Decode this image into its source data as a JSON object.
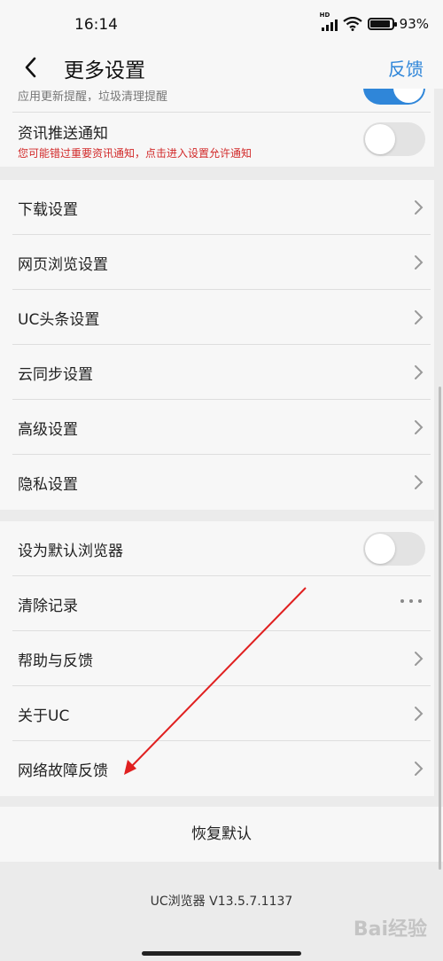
{
  "status_bar": {
    "time": "16:14",
    "network_badge": "HD",
    "battery": "93%"
  },
  "header": {
    "title": "更多设置",
    "feedback_label": "反馈"
  },
  "top_section": {
    "partial_sub_text": "应用更新提醒，垃圾清理提醒",
    "news_push": {
      "label": "资讯推送通知",
      "warning": "您可能错过重要资讯通知，点击进入设置允许通知",
      "enabled": false
    }
  },
  "settings_group": [
    {
      "label": "下载设置"
    },
    {
      "label": "网页浏览设置"
    },
    {
      "label": "UC头条设置"
    },
    {
      "label": "云同步设置"
    },
    {
      "label": "高级设置"
    },
    {
      "label": "隐私设置"
    }
  ],
  "misc_group": {
    "default_browser": {
      "label": "设为默认浏览器",
      "enabled": false
    },
    "clear_history": {
      "label": "清除记录"
    },
    "help_feedback": {
      "label": "帮助与反馈"
    },
    "about": {
      "label": "关于UC"
    },
    "network_feedback": {
      "label": "网络故障反馈"
    }
  },
  "restore_default": "恢复默认",
  "version": "UC浏览器 V13.5.7.1137",
  "watermark": "Bai经验",
  "colors": {
    "accent": "#2f86d9",
    "warning": "#d22a2a",
    "arrow": "#e02020"
  },
  "icons": {
    "back": "chevron-left-icon",
    "row_arrow": "chevron-right-icon",
    "more": "more-dots-icon"
  }
}
